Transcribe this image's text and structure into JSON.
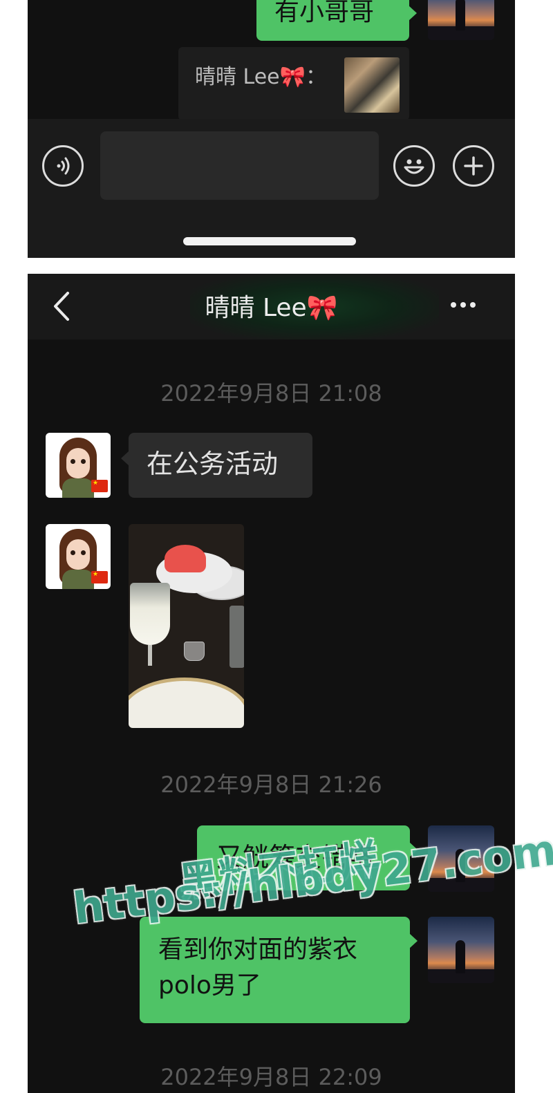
{
  "top_panel": {
    "sent_message": "有小哥哥",
    "quote": {
      "text": "晴晴 Lee🎀："
    },
    "input_bar": {
      "voice_icon": "voice-icon",
      "emoji_icon": "emoji-icon",
      "plus_icon": "plus-icon",
      "message_value": ""
    }
  },
  "bottom_panel": {
    "nav": {
      "back_icon": "chevron-left-icon",
      "title": "晴晴 Lee🎀",
      "more_icon": "more-icon"
    },
    "messages": [
      {
        "type": "timestamp",
        "text": "2022年9月8日 21:08"
      },
      {
        "type": "received_text",
        "text": "在公务活动"
      },
      {
        "type": "received_image",
        "description": "photo"
      },
      {
        "type": "timestamp",
        "text": "2022年9月8日 21:26"
      },
      {
        "type": "sent_text",
        "text": "又觥筹交错咯"
      },
      {
        "type": "sent_text",
        "text": "看到你对面的紫衣polo男了"
      },
      {
        "type": "timestamp",
        "text": "2022年9月8日 22:09"
      }
    ]
  },
  "watermark": {
    "line1": "黑料不打烊",
    "line2": "https://hlbdy27.com"
  },
  "colors": {
    "sent_bubble": "#4fc366",
    "received_bubble": "#2c2c2c",
    "background": "#111111"
  }
}
